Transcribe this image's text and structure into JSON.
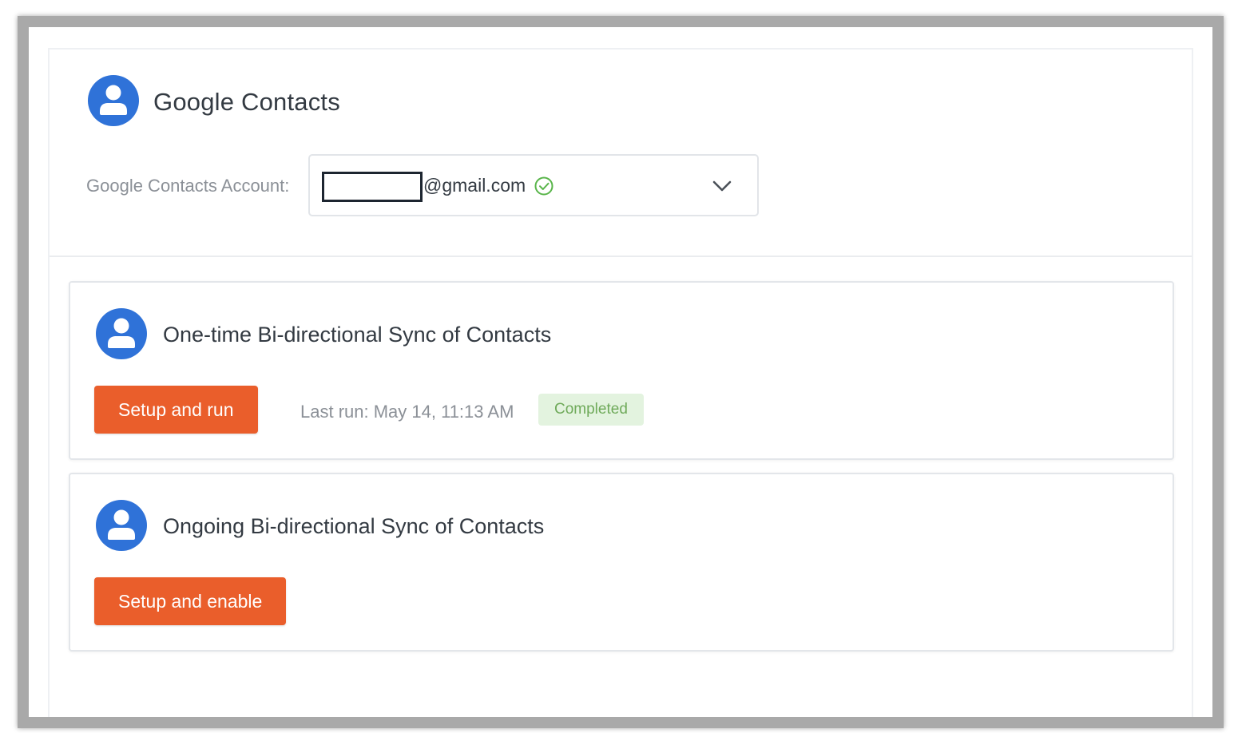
{
  "app": {
    "title": "Google Contacts",
    "icon": "account-circle-icon"
  },
  "account": {
    "label": "Google Contacts Account:",
    "email_domain": "@gmail.com",
    "verified_icon": "check-circle-icon",
    "dropdown_icon": "chevron-down-icon"
  },
  "sync_cards": [
    {
      "title": "One-time Bi-directional Sync of Contacts",
      "icon": "account-circle-icon",
      "button_label": "Setup and run",
      "last_run": "Last run: May 14, 11:13 AM",
      "status": "Completed"
    },
    {
      "title": "Ongoing Bi-directional Sync of Contacts",
      "icon": "account-circle-icon",
      "button_label": "Setup and enable"
    }
  ],
  "colors": {
    "accent_blue": "#2f72d8",
    "button_orange": "#ea5e2b",
    "success_green": "#6faa5a",
    "success_bg": "#e3f3df"
  }
}
